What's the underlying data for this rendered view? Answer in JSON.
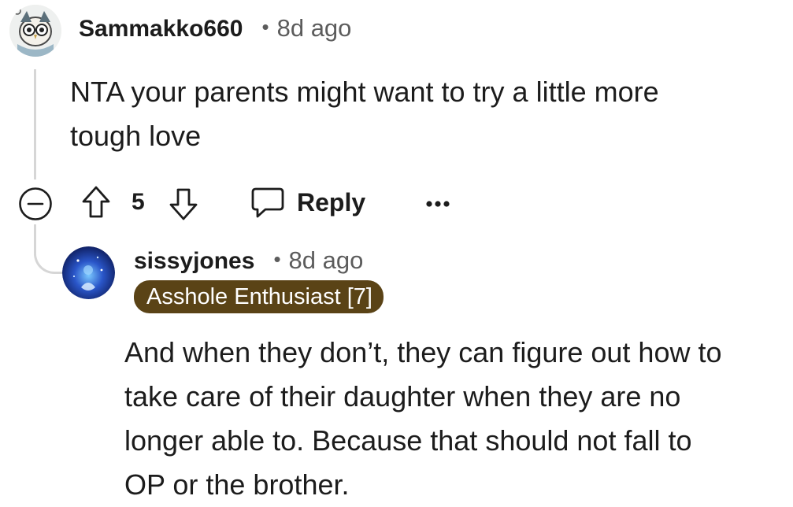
{
  "comments": [
    {
      "username": "Sammakko660",
      "separator": "•",
      "timestamp": "8d ago",
      "body_lines": [
        "NTA your parents might want to try a little more",
        "tough love"
      ],
      "vote_count": "5",
      "reply_label": "Reply",
      "more_label": "•••"
    },
    {
      "username": "sissyjones",
      "separator": "•",
      "timestamp": "8d ago",
      "flair": "Asshole Enthusiast [7]",
      "body_lines": [
        "And when they don’t, they can figure out how to",
        "take care of their daughter when they are no",
        "longer able to. Because that should not fall to",
        "OP or the brother."
      ]
    }
  ],
  "icons": {
    "collapse": "collapse-minus-icon",
    "upvote": "upvote-arrow-icon",
    "downvote": "downvote-arrow-icon",
    "reply": "speech-bubble-icon",
    "more": "more-options-icon"
  },
  "colors": {
    "flair_background": "#5a4316",
    "thread_line": "#d6d6d6",
    "secondary_text": "#5c5c5c"
  }
}
